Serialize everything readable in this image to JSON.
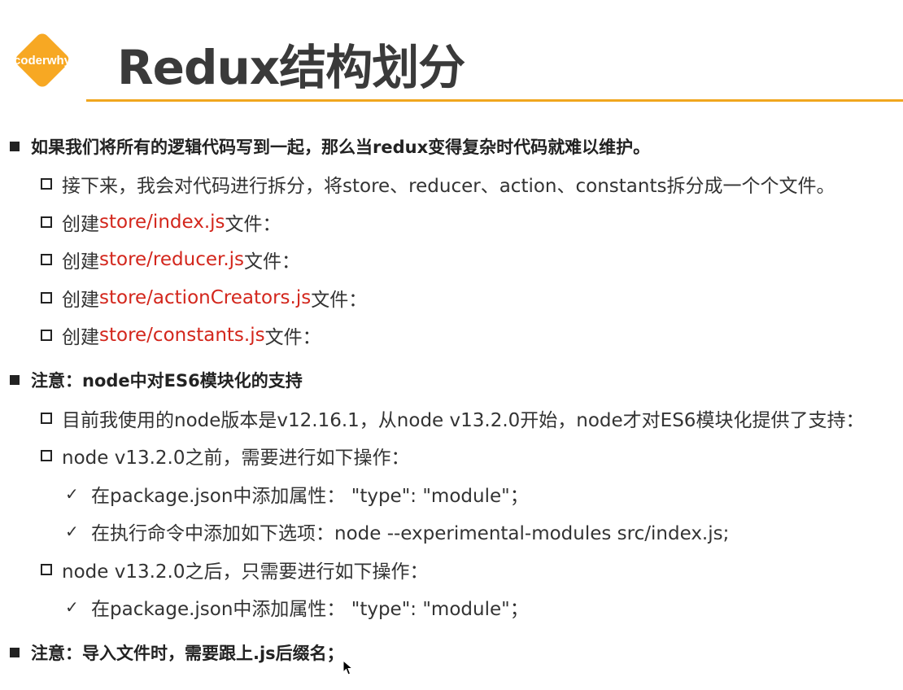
{
  "logo": {
    "text": "coderwhy",
    "color": "#f7a823"
  },
  "title": "Redux结构划分",
  "accent_color": "#f0a61e",
  "code_color": "#d3261c",
  "items": {
    "b1": {
      "text": "如果我们将所有的逻辑代码写到一起，那么当redux变得复杂时代码就难以维护。"
    },
    "b1_s1": {
      "text": "接下来，我会对代码进行拆分，将store、reducer、action、constants拆分成一个个文件。"
    },
    "b1_s2": {
      "prefix": "创建",
      "code": "store/index.js",
      "suffix": "文件："
    },
    "b1_s3": {
      "prefix": "创建",
      "code": "store/reducer.js",
      "suffix": "文件："
    },
    "b1_s4": {
      "prefix": "创建",
      "code": "store/actionCreators.js",
      "suffix": "文件："
    },
    "b1_s5": {
      "prefix": "创建",
      "code": "store/constants.js",
      "suffix": "文件："
    },
    "b2": {
      "text": "注意：node中对ES6模块化的支持"
    },
    "b2_s1": {
      "text": "目前我使用的node版本是v12.16.1，从node v13.2.0开始，node才对ES6模块化提供了支持："
    },
    "b2_s2": {
      "text": "node v13.2.0之前，需要进行如下操作："
    },
    "b2_s2_c1": {
      "text": "在package.json中添加属性： \"type\": \"module\"；"
    },
    "b2_s2_c2": {
      "text": "在执行命令中添加如下选项：node --experimental-modules src/index.js;"
    },
    "b2_s3": {
      "text": "node v13.2.0之后，只需要进行如下操作："
    },
    "b2_s3_c1": {
      "text": "在package.json中添加属性： \"type\": \"module\"；"
    },
    "b3": {
      "text": "注意：导入文件时，需要跟上.js后缀名；"
    }
  }
}
